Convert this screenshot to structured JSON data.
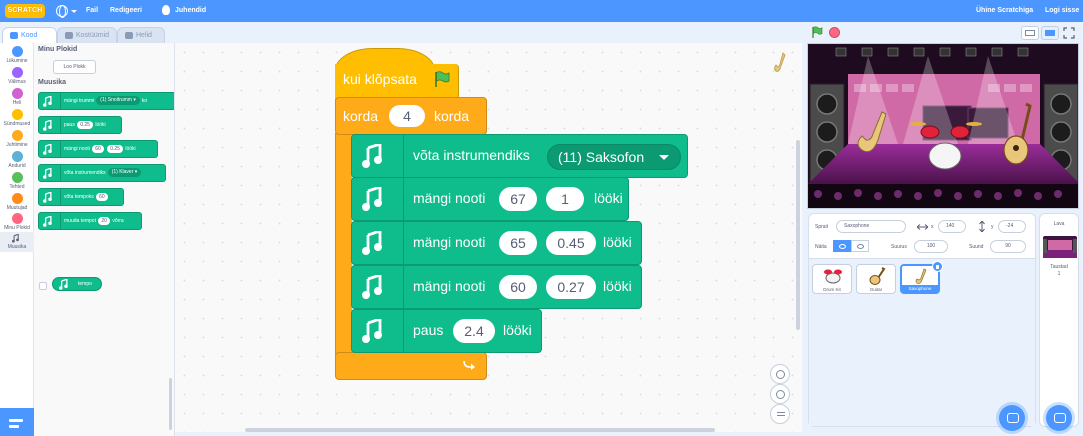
{
  "menubar": {
    "logo": "SCRATCH",
    "file": "Fail",
    "edit": "Redigeeri",
    "tutorials": "Juhendid",
    "join": "Ühine Scratchiga",
    "signin": "Logi sisse"
  },
  "tabs": {
    "code": "Kood",
    "costumes": "Kostüümid",
    "sounds": "Helid"
  },
  "categories": [
    {
      "label": "Liikumine",
      "color": "#4c97ff"
    },
    {
      "label": "Välimus",
      "color": "#9966ff"
    },
    {
      "label": "Heli",
      "color": "#cf63cf"
    },
    {
      "label": "Sündmused",
      "color": "#ffbf00"
    },
    {
      "label": "Juhtimine",
      "color": "#ffab19"
    },
    {
      "label": "Andurid",
      "color": "#5cb1d6"
    },
    {
      "label": "Tehted",
      "color": "#59c059"
    },
    {
      "label": "Muutujad",
      "color": "#ff8c1a"
    },
    {
      "label": "Minu Plokid",
      "color": "#ff6680"
    },
    {
      "label": "Muusika",
      "color": "#0fbd8c"
    }
  ],
  "palette": {
    "my_blocks_heading": "Minu Plokid",
    "make_block": "Loo Plokk",
    "music_heading": "Muusika",
    "blocks": [
      {
        "text": "mängi trummi",
        "dropdown": "(1) Snoitrumm",
        "tail": "ko"
      },
      {
        "text": "paus",
        "value": "0.25",
        "tail": "lööki"
      },
      {
        "text": "mängi nooti",
        "value": "60",
        "value2": "0.25",
        "tail": "lööki"
      },
      {
        "text": "võta instrumendiks",
        "dropdown": "(1) Klaver"
      },
      {
        "text": "võta tempoks",
        "value": "60"
      },
      {
        "text": "muuda tempot",
        "value": "20",
        "tail": "võrra"
      }
    ],
    "reporter": "tempo"
  },
  "script": {
    "hat": "kui klõpsata",
    "repeat_label": "korda",
    "repeat_value": "4",
    "repeat_suffix": "korda",
    "instrument_label": "võta instrumendiks",
    "instrument_value": "(11) Saksofon",
    "notes": [
      {
        "label": "mängi nooti",
        "note": "67",
        "beats": "1",
        "suffix": "lööki"
      },
      {
        "label": "mängi nooti",
        "note": "65",
        "beats": "0.45",
        "suffix": "lööki"
      },
      {
        "label": "mängi nooti",
        "note": "60",
        "beats": "0.27",
        "suffix": "lööki"
      }
    ],
    "rest_label": "paus",
    "rest_value": "2.4",
    "rest_suffix": "lööki"
  },
  "sprite_info": {
    "sprite_label": "Sprait",
    "sprite_name": "Saxophone",
    "x_label": "x",
    "x_value": "140",
    "y_label": "y",
    "y_value": "-24",
    "show_label": "Näita",
    "size_label": "Suurus",
    "size_value": "100",
    "direction_label": "Suund",
    "direction_value": "90"
  },
  "sprites": [
    {
      "name": "Drum Kit"
    },
    {
      "name": "Guitar"
    },
    {
      "name": "Saxophone"
    }
  ],
  "stage_panel": {
    "label": "Lava",
    "backdrops_label": "Taustad",
    "backdrops_count": "1"
  },
  "colors": {
    "accent": "#4c97ff",
    "music": "#0fbd8c",
    "events": "#ffbf00",
    "control": "#ffab19"
  }
}
